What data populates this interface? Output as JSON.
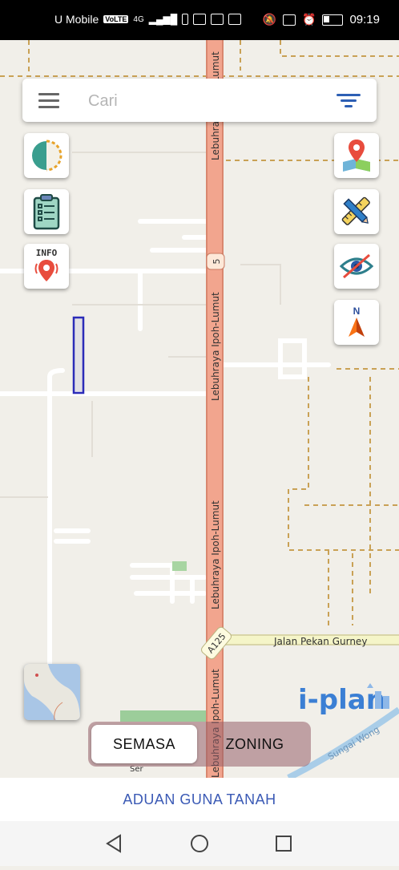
{
  "status_bar": {
    "carrier": "U Mobile",
    "volte": "VoLTE",
    "network": "4G",
    "time": "09:19"
  },
  "search": {
    "placeholder": "Cari"
  },
  "map": {
    "road_main": "Lebuhraya Ipoh-Lumut",
    "route_shield_5": "5",
    "route_shield_a125": "A125",
    "road_gurney": "Jalan Pekan Gurney",
    "river": "Sungai Wong",
    "partial_label": "Ser"
  },
  "left_buttons": [
    "layer-toggle-icon",
    "clipboard-list-icon",
    "info-pin-icon"
  ],
  "right_buttons": [
    "map-pin-icon",
    "ruler-pencil-icon",
    "hide-eye-icon",
    "north-compass-icon"
  ],
  "info_label": "INFO",
  "compass_label": "N",
  "brand": {
    "logo_text": "i-plan"
  },
  "toggle": {
    "semasa": "SEMASA",
    "zoning": "ZONING",
    "selected": "SEMASA"
  },
  "bottom_action": "ADUAN GUNA TANAH",
  "colors": {
    "main_road": "#f2a58e",
    "secondary_road": "#f5f5c8",
    "boundary": "#c9a155",
    "selection": "#2b2bb8",
    "accent_blue": "#3b5ab5"
  }
}
